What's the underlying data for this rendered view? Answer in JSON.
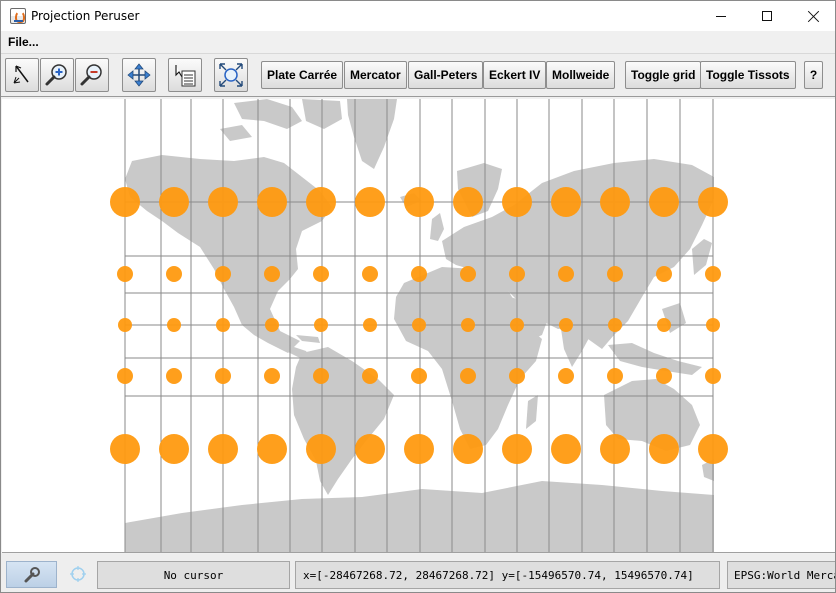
{
  "window": {
    "title": "Projection Peruser",
    "controls": {
      "minimize_icon": "minimize-icon",
      "maximize_icon": "maximize-icon",
      "close_icon": "close-icon"
    }
  },
  "menu": {
    "file_label": "File..."
  },
  "toolbar": {
    "tools": [
      {
        "name": "select-tool",
        "icon": "arrow-pointer-icon"
      },
      {
        "name": "zoom-in-tool",
        "icon": "zoom-in-icon"
      },
      {
        "name": "zoom-out-tool",
        "icon": "zoom-out-icon"
      },
      {
        "name": "pan-tool",
        "icon": "pan-arrows-icon"
      },
      {
        "name": "info-tool",
        "icon": "info-cursor-icon"
      },
      {
        "name": "reset-view-tool",
        "icon": "zoom-extent-icon"
      }
    ],
    "projections": [
      "Plate Carrée",
      "Mercator",
      "Gall-Peters",
      "Eckert IV",
      "Mollweide"
    ],
    "toggle_grid_label": "Toggle grid",
    "toggle_tissots_label": "Toggle Tissots",
    "help_label": "?"
  },
  "map": {
    "projection": "Mercator",
    "grid_visible": true,
    "tissot_visible": true,
    "land_color": "#c9c9c9",
    "ocean_color": "#ffffff",
    "graticule_color": "#8a8a8a",
    "tissot_color": "#ff9a10"
  },
  "status": {
    "wrench_icon": "wrench-icon",
    "crosshair_icon": "crosshair-icon",
    "cursor_text": "No cursor",
    "extent_text": "x=[-28467268.72, 28467268.72] y=[-15496570.74, 15496570.74]",
    "crs_text": "EPSG:World Mercator"
  }
}
